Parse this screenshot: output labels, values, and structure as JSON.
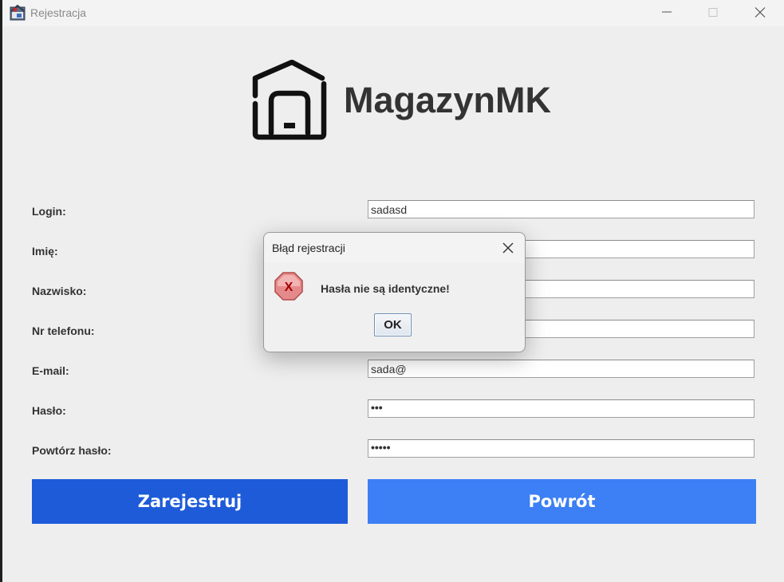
{
  "window": {
    "title": "Rejestracja",
    "icon": "app-icon",
    "controls": [
      "minimize-icon",
      "maximize-icon",
      "close-icon"
    ]
  },
  "brand": {
    "name": "MagazynMK",
    "logo_icon": "warehouse-house-icon"
  },
  "form": {
    "fields": [
      {
        "label": "Login:",
        "value": "sadasd",
        "type": "text"
      },
      {
        "label": "Imię:",
        "value": "",
        "type": "text"
      },
      {
        "label": "Nazwisko:",
        "value": "",
        "type": "text"
      },
      {
        "label": "Nr telefonu:",
        "value": "",
        "type": "text"
      },
      {
        "label": "E-mail:",
        "value": "sada@",
        "type": "text"
      },
      {
        "label": "Hasło:",
        "value": "•••",
        "type": "password"
      },
      {
        "label": "Powtórz hasło:",
        "value": "•••••",
        "type": "password"
      }
    ],
    "register_button": "Zarejestruj",
    "back_button": "Powrót"
  },
  "dialog": {
    "title": "Błąd rejestracji",
    "message": "Hasła nie są identyczne!",
    "ok_label": "OK",
    "icon": "error-icon"
  },
  "colors": {
    "register_button": "#1e5bd9",
    "back_button": "#3d7ff4",
    "window_bg": "#eeeeee",
    "error_icon": "#e07b7b"
  }
}
